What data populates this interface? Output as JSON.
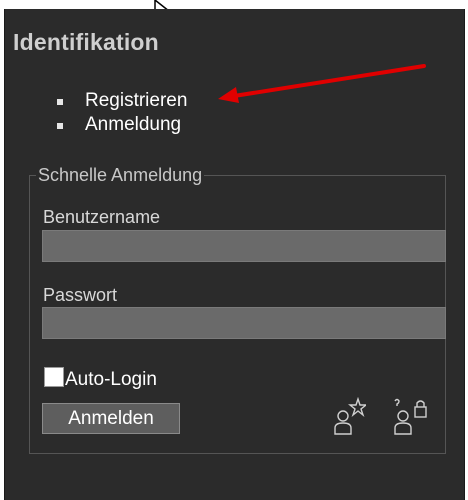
{
  "panel": {
    "title": "Identifikation",
    "links": [
      {
        "label": "Registrieren"
      },
      {
        "label": "Anmeldung"
      }
    ]
  },
  "quick_login": {
    "legend": "Schnelle Anmeldung",
    "username": {
      "label": "Benutzername",
      "value": "",
      "placeholder": ""
    },
    "password": {
      "label": "Passwort",
      "value": "",
      "placeholder": ""
    },
    "auto_login": {
      "label": "Auto-Login",
      "checked": false
    },
    "submit_label": "Anmelden",
    "icons": [
      "register-user-icon",
      "forgot-password-icon"
    ]
  },
  "colors": {
    "panel_background": "#2b2b2b",
    "input_background": "#6a6a6a",
    "arrow": "#e00000",
    "title": "#cfcfcf"
  }
}
